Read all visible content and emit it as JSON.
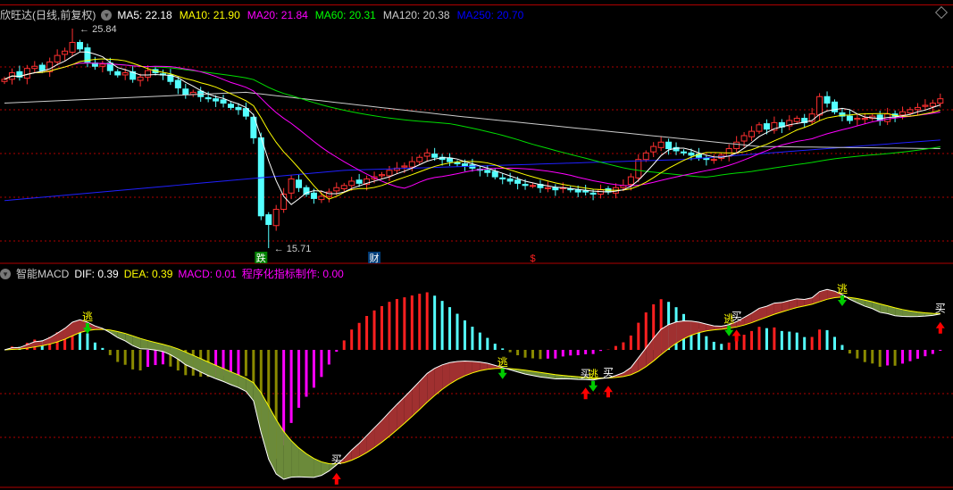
{
  "header": {
    "stock_name": "欣旺达(日线,前复权)",
    "ma": [
      {
        "label": "MA5: 22.18",
        "color": "#ffffff"
      },
      {
        "label": "MA10: 21.90",
        "color": "#ffff00"
      },
      {
        "label": "MA20: 21.84",
        "color": "#ff00ff"
      },
      {
        "label": "MA60: 20.31",
        "color": "#00ff00"
      },
      {
        "label": "MA120: 20.38",
        "color": "#cccccc"
      },
      {
        "label": "MA250: 20.70",
        "color": "#0000ff"
      }
    ]
  },
  "macd_header": {
    "name": "智能MACD",
    "dif": "DIF: 0.39",
    "dea": "DEA: 0.39",
    "macd": "MACD: 0.01",
    "custom": "程序化指标制作: 0.00"
  },
  "colors": {
    "up": "#ff3030",
    "down": "#54ffff",
    "grid": "#b00000"
  },
  "chart_data": {
    "type": "candlestick",
    "high_label": "25.84",
    "low_label": "15.71",
    "high_index": 9,
    "low_index": 35,
    "price_range": [
      15.71,
      25.84
    ],
    "closes": [
      23.5,
      23.8,
      23.6,
      24.0,
      24.1,
      23.9,
      24.3,
      24.6,
      24.8,
      25.2,
      24.9,
      24.3,
      24.1,
      24.2,
      23.9,
      23.7,
      23.8,
      23.5,
      23.6,
      23.9,
      23.8,
      23.7,
      23.4,
      23.1,
      22.8,
      22.9,
      22.7,
      22.6,
      22.5,
      22.4,
      22.2,
      22.1,
      21.8,
      20.8,
      17.2,
      16.8,
      17.5,
      18.2,
      18.9,
      18.5,
      18.2,
      18.0,
      18.1,
      18.3,
      18.5,
      18.6,
      18.8,
      18.7,
      18.9,
      19.0,
      19.1,
      19.3,
      19.4,
      19.5,
      19.7,
      19.9,
      20.1,
      19.9,
      19.8,
      19.7,
      19.6,
      19.5,
      19.4,
      19.3,
      19.2,
      19.0,
      18.9,
      18.8,
      18.7,
      18.6,
      18.6,
      18.5,
      18.5,
      18.4,
      18.5,
      18.4,
      18.3,
      18.3,
      18.2,
      18.4,
      18.3,
      18.5,
      18.6,
      19.0,
      19.8,
      20.1,
      20.4,
      20.6,
      20.3,
      20.2,
      20.1,
      20.0,
      19.9,
      19.8,
      19.8,
      20.0,
      20.3,
      20.6,
      20.9,
      21.1,
      21.4,
      21.2,
      21.5,
      21.3,
      21.6,
      21.7,
      21.5,
      21.9,
      22.7,
      22.4,
      22.0,
      21.8,
      21.6,
      21.7,
      21.7,
      21.8,
      21.6,
      21.9,
      21.8,
      22.0,
      22.1,
      22.2,
      22.3,
      22.4,
      22.6
    ],
    "ma120_anchors": [
      [
        0,
        22.4
      ],
      [
        32,
        22.9
      ],
      [
        60,
        21.8
      ],
      [
        100,
        20.4
      ],
      [
        124,
        20.3
      ]
    ],
    "ma250_anchors": [
      [
        0,
        17.9
      ],
      [
        45,
        19.3
      ],
      [
        90,
        19.8
      ],
      [
        124,
        20.7
      ]
    ],
    "badges": [
      {
        "index": 34,
        "text": "跌",
        "bg": "#008000"
      },
      {
        "index": 49,
        "text": "财",
        "bg": "#003c78"
      },
      {
        "index": 70,
        "text": "$",
        "bg": "transparent"
      }
    ],
    "signals": [
      {
        "index": 11,
        "text": "逃",
        "type": "sell"
      },
      {
        "index": 44,
        "text": "买",
        "type": "buy"
      },
      {
        "index": 66,
        "text": "逃",
        "type": "sell"
      },
      {
        "index": 77,
        "text": "买",
        "type": "buy"
      },
      {
        "index": 78,
        "text": "逃",
        "type": "sell"
      },
      {
        "index": 80,
        "text": "买",
        "type": "buy"
      },
      {
        "index": 96,
        "text": "逃",
        "type": "sell"
      },
      {
        "index": 97,
        "text": "买",
        "type": "buy"
      },
      {
        "index": 111,
        "text": "逃",
        "type": "sell"
      },
      {
        "index": 124,
        "text": "买",
        "type": "buy"
      }
    ]
  }
}
